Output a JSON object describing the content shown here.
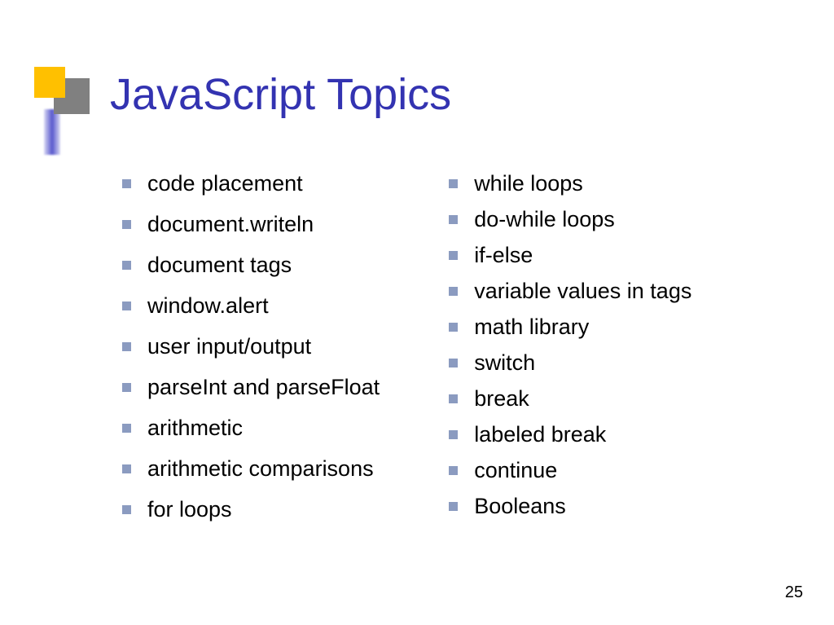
{
  "title": "JavaScript Topics",
  "leftColumn": [
    "code placement",
    "document.writeln",
    "document tags",
    "window.alert",
    "user input/output",
    "parseInt and parseFloat",
    "arithmetic",
    "arithmetic comparisons",
    "for loops"
  ],
  "rightColumn": [
    "while loops",
    "do-while loops",
    "if-else",
    "variable values in tags",
    "math library",
    "switch",
    "break",
    "labeled break",
    "continue",
    "Booleans"
  ],
  "pageNumber": "25"
}
